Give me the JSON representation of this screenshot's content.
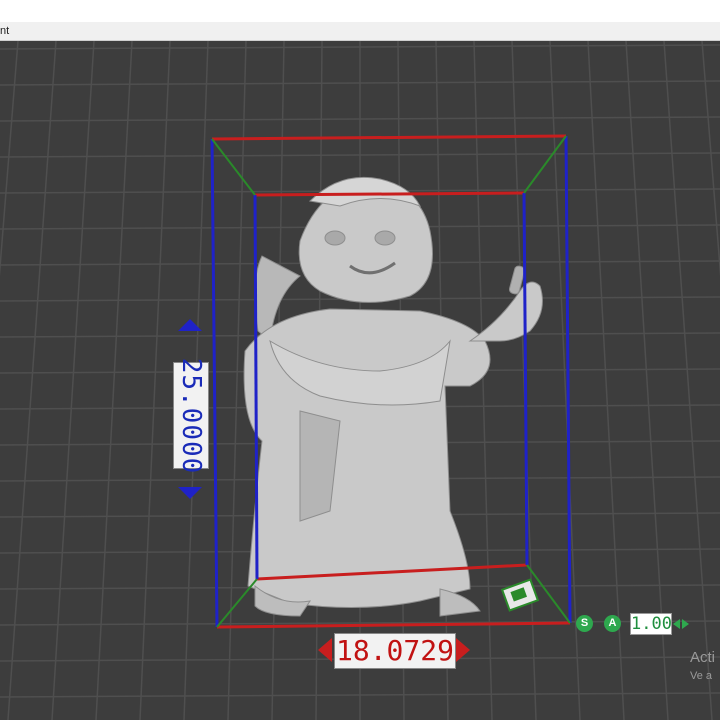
{
  "window": {
    "title_fragment": "nt"
  },
  "dimensions": {
    "height_value": "25.0000",
    "width_value": "18.0729"
  },
  "scale": {
    "s_label": "S",
    "a_label": "A",
    "value": "1.00"
  },
  "watermark": {
    "line1": "Acti",
    "line2": "Ve a"
  },
  "colors": {
    "grid": "#4f4f4f",
    "bbox_blue": "#1f22c8",
    "bbox_red": "#c81e1e",
    "bbox_green": "#2a8a2a",
    "accent_green": "#2ea84e"
  }
}
